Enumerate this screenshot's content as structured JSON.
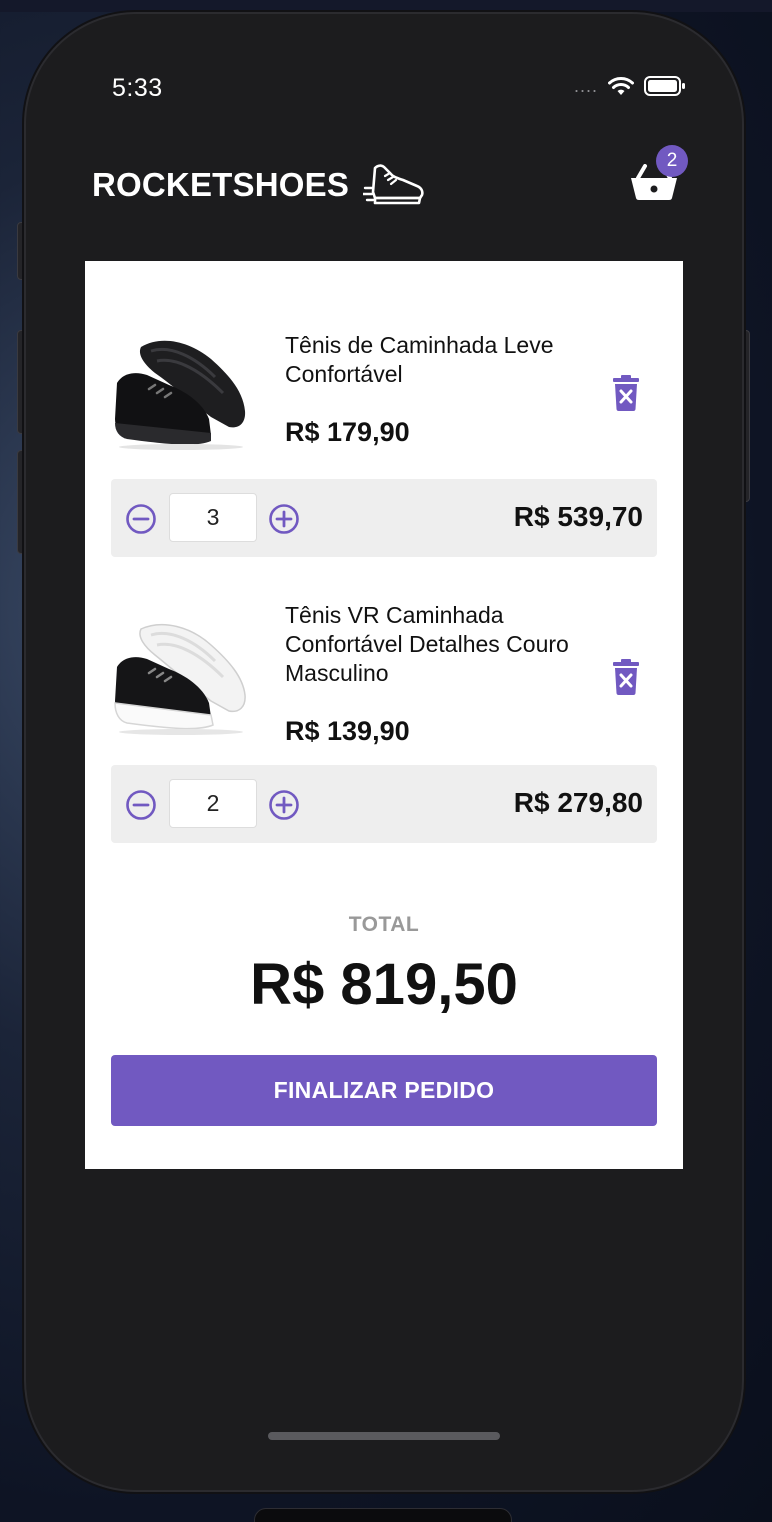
{
  "status_bar": {
    "time": "5:33",
    "signal_dots": "....",
    "icons": [
      "wifi-icon",
      "battery-icon"
    ]
  },
  "header": {
    "brand": "ROCKETSHOES",
    "logo_icon": "sneaker-icon",
    "cart_icon": "basket-icon",
    "cart_count": "2"
  },
  "cart": {
    "items": [
      {
        "title": "Tênis de Caminhada Leve Confortável",
        "price": "R$ 179,90",
        "quantity": "3",
        "subtotal": "R$ 539,70",
        "image": "black-sneaker"
      },
      {
        "title": "Tênis VR Caminhada Confortável Detalhes Couro Masculino",
        "price": "R$ 139,90",
        "quantity": "2",
        "subtotal": "R$ 279,80",
        "image": "black-white-sneaker"
      }
    ],
    "total_label": "TOTAL",
    "total_value": "R$ 819,50",
    "checkout_label": "FINALIZAR PEDIDO"
  },
  "colors": {
    "accent": "#7159c1",
    "background": "#1c1c1e",
    "card": "#ffffff",
    "qty_bar": "#eeeeee"
  }
}
